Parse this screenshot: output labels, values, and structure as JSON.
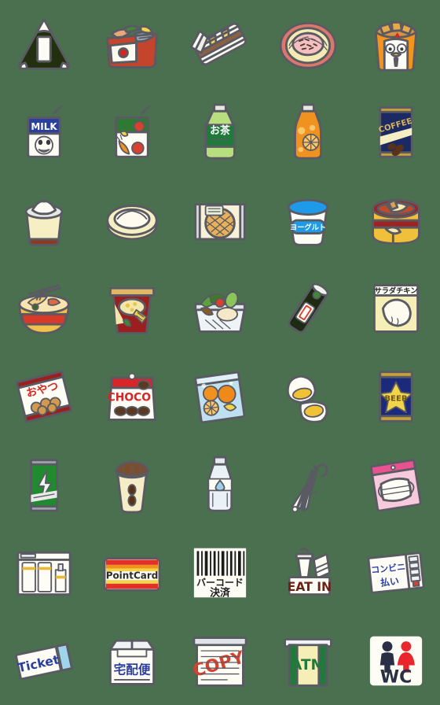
{
  "sheet": {
    "title": "Convenience Store Emoji Sheet",
    "columns": 5,
    "rows": 8,
    "background_color": "#4b7050",
    "outline_color": "#5a5a62"
  },
  "items": [
    {
      "id": "onigiri",
      "name": "rice-ball-onigiri",
      "label": "",
      "row": 1,
      "col": 1,
      "colors": [
        "#20300f",
        "#ffffff"
      ]
    },
    {
      "id": "bento-fish",
      "name": "fish-bento-box",
      "label": "",
      "row": 1,
      "col": 2,
      "colors": [
        "#c4452c",
        "#ffffff",
        "#e8a15c"
      ]
    },
    {
      "id": "sandwich",
      "name": "sandwich-pack",
      "label": "",
      "row": 1,
      "col": 3,
      "colors": [
        "#ffffff",
        "#f2d65b",
        "#8a6243"
      ]
    },
    {
      "id": "noodles-bowl",
      "name": "cold-noodles-bowl",
      "label": "",
      "row": 1,
      "col": 4,
      "colors": [
        "#d9786b",
        "#f2e9b8",
        "#f6bfbf"
      ]
    },
    {
      "id": "fried-chicken",
      "name": "fried-chicken-cup",
      "label": "",
      "row": 1,
      "col": 5,
      "colors": [
        "#f3941d",
        "#d89242",
        "#ffffff"
      ]
    },
    {
      "id": "milk",
      "name": "milk-carton-drink",
      "label": "MILK",
      "row": 2,
      "col": 1,
      "colors": [
        "#2a3fa0",
        "#ffffff"
      ]
    },
    {
      "id": "veggie-juice",
      "name": "vegetable-juice-carton",
      "label": "",
      "row": 2,
      "col": 2,
      "colors": [
        "#2f7a32",
        "#ffffff",
        "#d8402f"
      ]
    },
    {
      "id": "green-tea",
      "name": "green-tea-bottle",
      "label": "お茶",
      "row": 2,
      "col": 3,
      "colors": [
        "#1f7a3c",
        "#b7df7f"
      ]
    },
    {
      "id": "orange-juice",
      "name": "orange-juice-bottle",
      "label": "",
      "row": 2,
      "col": 4,
      "colors": [
        "#f0921f",
        "#fbc56a"
      ]
    },
    {
      "id": "canned-coffee",
      "name": "canned-coffee",
      "label": "COFFEE",
      "row": 2,
      "col": 5,
      "colors": [
        "#1b2a63",
        "#d9b35c",
        "#f5eec4"
      ]
    },
    {
      "id": "oden-cup",
      "name": "oden-cup",
      "label": "",
      "row": 3,
      "col": 1,
      "colors": [
        "#f7efc4",
        "#ffffff",
        "#c4452c"
      ]
    },
    {
      "id": "nikuman",
      "name": "steamed-bun-nikuman",
      "label": "",
      "row": 3,
      "col": 2,
      "colors": [
        "#f7e7ad",
        "#fffaf0"
      ]
    },
    {
      "id": "melon-bread",
      "name": "melon-bread-package",
      "label": "",
      "row": 3,
      "col": 3,
      "colors": [
        "#efe4a8",
        "#e8b05a",
        "#cfd4d6"
      ]
    },
    {
      "id": "yogurt",
      "name": "yogurt-cup",
      "label": "ヨーグルト",
      "row": 3,
      "col": 4,
      "colors": [
        "#1e9ae8",
        "#ffffff"
      ]
    },
    {
      "id": "oden-pot",
      "name": "oden-pot",
      "label": "",
      "row": 3,
      "col": 5,
      "colors": [
        "#9b2525",
        "#f0c03a",
        "#f7eab0"
      ]
    },
    {
      "id": "ramen",
      "name": "ramen-bowl",
      "label": "",
      "row": 4,
      "col": 1,
      "colors": [
        "#d83a2a",
        "#f2c14c",
        "#f7e4b0"
      ]
    },
    {
      "id": "cup-noodle",
      "name": "instant-cup-noodle",
      "label": "",
      "row": 4,
      "col": 2,
      "colors": [
        "#9b1f1f",
        "#e0b766",
        "#f3e6ad"
      ]
    },
    {
      "id": "salad",
      "name": "salad-container",
      "label": "",
      "row": 4,
      "col": 3,
      "colors": [
        "#e8eef0",
        "#4f8f3a",
        "#d8402f"
      ]
    },
    {
      "id": "nori-roll",
      "name": "norimaki-sushi-roll",
      "label": "",
      "row": 4,
      "col": 4,
      "colors": [
        "#1d2b13",
        "#ffffff",
        "#d8402f"
      ]
    },
    {
      "id": "salad-chicken",
      "name": "salad-chicken-package",
      "label": "サラダチキン",
      "row": 4,
      "col": 5,
      "colors": [
        "#f5eeb6",
        "#ffffff"
      ]
    },
    {
      "id": "snack-bag",
      "name": "snack-bag-oyatsu",
      "label": "おやつ",
      "row": 5,
      "col": 1,
      "colors": [
        "#9b1f1f",
        "#ffffff",
        "#d39a4e"
      ]
    },
    {
      "id": "choco-bag",
      "name": "chocolate-bag",
      "label": "CHOCO",
      "row": 5,
      "col": 2,
      "colors": [
        "#d8252a",
        "#ffffff",
        "#5a3a22"
      ]
    },
    {
      "id": "fruit-pack",
      "name": "cut-fruit-pack",
      "label": "",
      "row": 5,
      "col": 3,
      "colors": [
        "#bfe0f0",
        "#f0921f",
        "#f2d44a"
      ]
    },
    {
      "id": "boiled-egg",
      "name": "boiled-egg-halves",
      "label": "",
      "row": 5,
      "col": 4,
      "colors": [
        "#ffffff",
        "#f2c235"
      ]
    },
    {
      "id": "beer-can",
      "name": "beer-can",
      "label": "BEER",
      "row": 5,
      "col": 5,
      "colors": [
        "#1b2a7a",
        "#f2d44a",
        "#c8a33c"
      ]
    },
    {
      "id": "energy-drink",
      "name": "energy-drink-can",
      "label": "",
      "row": 6,
      "col": 1,
      "colors": [
        "#1f8a2e",
        "#ffffff",
        "#9aa3a8"
      ]
    },
    {
      "id": "hot-coffee",
      "name": "hot-coffee-cup",
      "label": "",
      "row": 6,
      "col": 2,
      "colors": [
        "#6b4227",
        "#f5edc8"
      ]
    },
    {
      "id": "water-bottle",
      "name": "water-bottle",
      "label": "",
      "row": 6,
      "col": 3,
      "colors": [
        "#dbe7ef",
        "#ffffff"
      ]
    },
    {
      "id": "umbrella",
      "name": "folded-umbrella",
      "label": "",
      "row": 6,
      "col": 4,
      "colors": [
        "#ffffff",
        "#8a8f94"
      ]
    },
    {
      "id": "mask-pack",
      "name": "face-mask-package",
      "label": "",
      "row": 6,
      "col": 5,
      "colors": [
        "#e8528f",
        "#f6c9dc",
        "#ffffff"
      ]
    },
    {
      "id": "toiletries",
      "name": "toiletries-shelf",
      "label": "",
      "row": 7,
      "col": 1,
      "colors": [
        "#ffffff",
        "#e8b93a",
        "#cfd4d6"
      ]
    },
    {
      "id": "point-card",
      "name": "point-card",
      "label": "PointCard",
      "row": 7,
      "col": 2,
      "colors": [
        "#e03027",
        "#f0921f",
        "#f2d44a"
      ]
    },
    {
      "id": "barcode-pay",
      "name": "barcode-payment",
      "label": "バーコード 決済",
      "row": 7,
      "col": 3,
      "colors": [
        "#ffffff",
        "#1b1b1b"
      ]
    },
    {
      "id": "eat-in",
      "name": "eat-in-sign",
      "label": "EAT IN",
      "row": 7,
      "col": 4,
      "colors": [
        "#6b2318",
        "#ffffff",
        "#e8b93a"
      ]
    },
    {
      "id": "konbini-pay",
      "name": "konbini-payment-slip",
      "label": "コンビニ 払い",
      "row": 7,
      "col": 5,
      "colors": [
        "#ffffff",
        "#2a3fa0",
        "#d8402f"
      ]
    },
    {
      "id": "ticket",
      "name": "ticket",
      "label": "Ticket",
      "row": 8,
      "col": 1,
      "colors": [
        "#ffffff",
        "#9fd4ea",
        "#2a3fa0"
      ]
    },
    {
      "id": "delivery-box",
      "name": "delivery-box-takuhaibin",
      "label": "宅配便",
      "row": 8,
      "col": 2,
      "colors": [
        "#ffffff",
        "#2a3fa0",
        "#d8402f"
      ]
    },
    {
      "id": "copy-machine",
      "name": "copy-document",
      "label": "COPY",
      "row": 8,
      "col": 3,
      "colors": [
        "#ffffff",
        "#d8402f",
        "#9aa3a8"
      ]
    },
    {
      "id": "atm",
      "name": "atm-machine",
      "label": "ATM",
      "row": 8,
      "col": 4,
      "colors": [
        "#1f7a3c",
        "#f5eeb6"
      ]
    },
    {
      "id": "wc",
      "name": "restroom-wc-sign",
      "label": "WC",
      "row": 8,
      "col": 5,
      "colors": [
        "#ffffff",
        "#2b2f45",
        "#e8262c"
      ]
    }
  ]
}
